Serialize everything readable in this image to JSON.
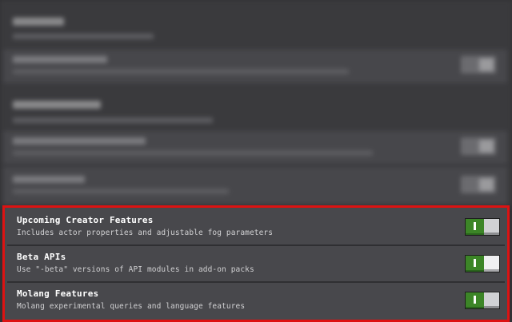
{
  "settings": [
    {
      "title": "Upcoming Creator Features",
      "description": "Includes actor properties and adjustable fog parameters",
      "enabled": true,
      "toggle_icon": "toggle-on-icon"
    },
    {
      "title": "Beta APIs",
      "description": "Use \"-beta\" versions of API modules in add-on packs",
      "enabled": true,
      "toggle_icon": "toggle-on-icon"
    },
    {
      "title": "Molang Features",
      "description": "Molang experimental queries and language features",
      "enabled": true,
      "toggle_icon": "toggle-on-icon"
    }
  ],
  "colors": {
    "highlight_border": "#dd1212",
    "toggle_on": "#3c8527",
    "row_background": "#48484c",
    "page_background": "#313134"
  }
}
